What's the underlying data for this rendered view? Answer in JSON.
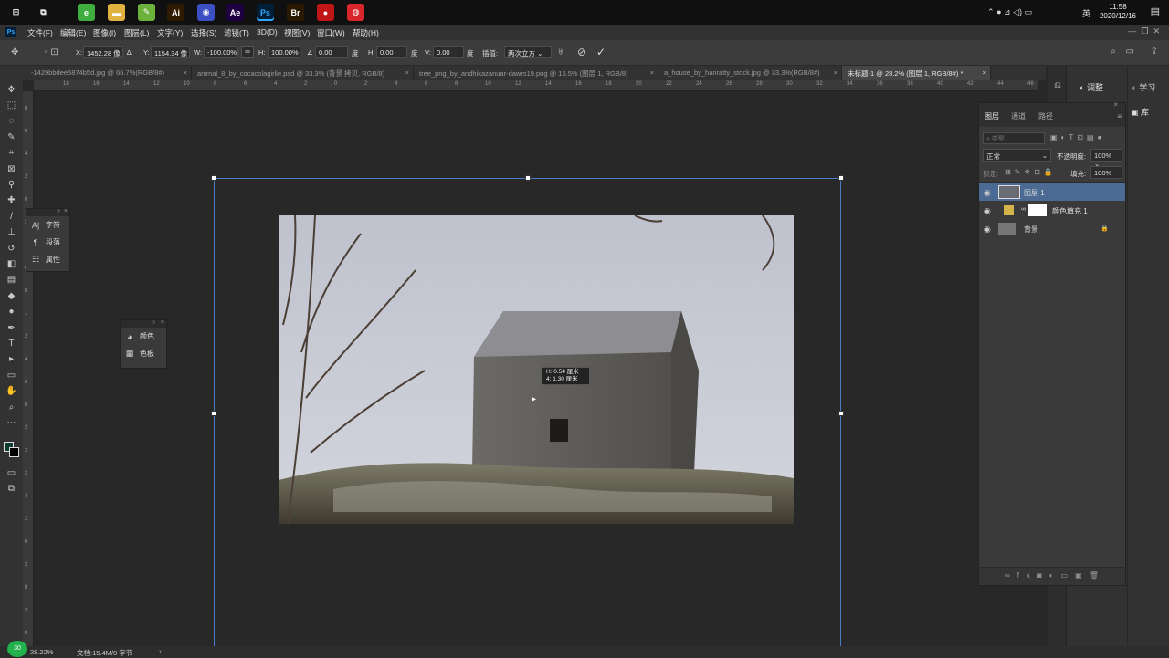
{
  "taskbar": {
    "apps": [
      {
        "name": "start",
        "label": "⊞",
        "color": "#101010"
      },
      {
        "name": "task-view",
        "label": "⧉",
        "color": "#101010"
      },
      {
        "name": "app-green",
        "label": "e",
        "color": "#3fae3f"
      },
      {
        "name": "file-explorer",
        "label": "▬",
        "color": "#e0b341"
      },
      {
        "name": "app-green-leaf",
        "label": "✎",
        "color": "#6cb13b"
      },
      {
        "name": "illustrator",
        "label": "Ai",
        "color": "#2e1a00"
      },
      {
        "name": "app-blue-circle",
        "label": "◉",
        "color": "#3b4ec2"
      },
      {
        "name": "after-effects",
        "label": "Ae",
        "color": "#1f0040"
      },
      {
        "name": "photoshop",
        "label": "Ps",
        "color": "#001e36"
      },
      {
        "name": "bridge",
        "label": "Br",
        "color": "#2a1800"
      },
      {
        "name": "recorder",
        "label": "●",
        "color": "#c01616"
      },
      {
        "name": "netease-music",
        "label": "◍",
        "color": "#d8262c"
      }
    ],
    "tray": {
      "ime": "英",
      "time": "11:58",
      "date": "2020/12/16"
    }
  },
  "menubar": {
    "items": [
      "文件(F)",
      "编辑(E)",
      "图像(I)",
      "图层(L)",
      "文字(Y)",
      "选择(S)",
      "滤镜(T)",
      "3D(D)",
      "视图(V)",
      "窗口(W)",
      "帮助(H)"
    ]
  },
  "options": {
    "x_label": "X:",
    "x_value": "1452.28 像",
    "y_label": "Y:",
    "y_value": "1154.34 像",
    "w_label": "W:",
    "w_value": "-100.00%",
    "h_label": "H:",
    "h_value": "100.00%",
    "angle_value": "0.00",
    "angle_unit": "度",
    "hskew_label": "H:",
    "hskew_value": "0.00",
    "hskew_unit": "度",
    "vskew_label": "V:",
    "vskew_value": "0.00",
    "vskew_unit": "度",
    "interp_label": "插值:",
    "interp_value": "两次立方"
  },
  "tabs": [
    "-1429bbdee6874b5d.jpg @ 66.7%(RGB/8#)",
    "animal_8_by_cocacolagirlie.psd @ 33.3% (背景 拷贝, RGB/8)",
    "tree_png_by_andhikazanuar-dawrs19.png @ 15.5% (图层 1, RGB/8)",
    "a_house_by_hanratty_stock.jpg @ 33.3%(RGB/8#)",
    "未标题-1 @ 28.2% (图层 1, RGB/8#) *"
  ],
  "ruler": {
    "h": [
      "18",
      "16",
      "14",
      "12",
      "10",
      "8",
      "6",
      "4",
      "2",
      "0",
      "2",
      "4",
      "6",
      "8",
      "10",
      "12",
      "14",
      "16",
      "18",
      "20",
      "22",
      "24",
      "26",
      "28",
      "30",
      "32",
      "34",
      "36",
      "38",
      "40",
      "42",
      "44",
      "46"
    ],
    "v": [
      "8",
      "6",
      "4",
      "2",
      "0",
      "2",
      "4",
      "6",
      "8",
      "1",
      "2",
      "4",
      "6",
      "8",
      "2",
      "2",
      "2",
      "4",
      "2",
      "6",
      "2",
      "8",
      "3",
      "0"
    ]
  },
  "float_type": {
    "items": [
      {
        "icon": "character-icon",
        "glyph": "A|",
        "label": "字符"
      },
      {
        "icon": "paragraph-icon",
        "glyph": "¶",
        "label": "段落"
      },
      {
        "icon": "properties-icon",
        "glyph": "☷",
        "label": "属性"
      }
    ]
  },
  "float_color": {
    "items": [
      {
        "icon": "color-icon",
        "glyph": "◕",
        "label": "颜色"
      },
      {
        "icon": "swatches-icon",
        "glyph": "▦",
        "label": "色板"
      }
    ]
  },
  "tooltip": {
    "line1": "H: 0.54 厘米",
    "line2": "4: 1.30 厘米"
  },
  "right_strip": {
    "adjust": "调整",
    "learn": "学习",
    "library": "库"
  },
  "layers_panel": {
    "tabs": [
      "图层",
      "通道",
      "路径"
    ],
    "filter_placeholder": "类型",
    "blend_mode": "正常",
    "opacity_label": "不透明度:",
    "opacity_value": "100%",
    "lock_label": "锁定:",
    "fill_label": "填充:",
    "fill_value": "100%",
    "layers": [
      {
        "name": "图层 1",
        "selected": true
      },
      {
        "name": "颜色填充 1",
        "selected": false
      },
      {
        "name": "背景",
        "selected": false,
        "locked": true
      }
    ]
  },
  "status": {
    "zoom": "28.22%",
    "doc": "文档:15.4M/0 字节",
    "badge": "30"
  },
  "colors": {
    "accent": "#1473e6",
    "selected_layer": "#4b6a94",
    "transform_line": "#4a7cc9"
  }
}
